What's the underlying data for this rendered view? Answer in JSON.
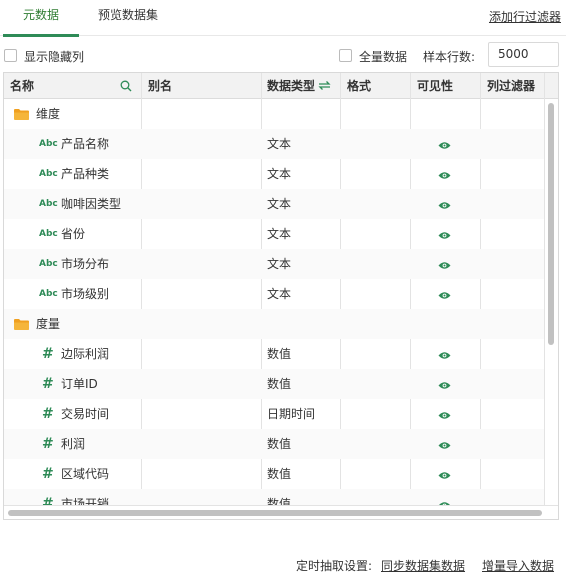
{
  "tabs": [
    {
      "label": "元数据",
      "active": true
    },
    {
      "label": "预览数据集",
      "active": false
    }
  ],
  "row_filter_link": "添加行过滤器",
  "options": {
    "show_hidden_label": "显示隐藏列",
    "all_data_label": "全量数据",
    "sample_rows_label": "样本行数:",
    "sample_rows_value": "5000"
  },
  "table": {
    "headers": {
      "name": "名称",
      "alias": "别名",
      "data_type": "数据类型",
      "format": "格式",
      "visibility": "可见性",
      "column_filter": "列过滤器"
    },
    "rows": [
      {
        "kind": "folder",
        "name": "维度"
      },
      {
        "kind": "text",
        "icon": "Abc",
        "name": "产品名称",
        "type": "文本",
        "visible": true
      },
      {
        "kind": "text",
        "icon": "Abc",
        "name": "产品种类",
        "type": "文本",
        "visible": true
      },
      {
        "kind": "text",
        "icon": "Abc",
        "name": "咖啡因类型",
        "type": "文本",
        "visible": true
      },
      {
        "kind": "text",
        "icon": "Abc",
        "name": "省份",
        "type": "文本",
        "visible": true
      },
      {
        "kind": "text",
        "icon": "Abc",
        "name": "市场分布",
        "type": "文本",
        "visible": true
      },
      {
        "kind": "text",
        "icon": "Abc",
        "name": "市场级别",
        "type": "文本",
        "visible": true
      },
      {
        "kind": "folder",
        "name": "度量"
      },
      {
        "kind": "number",
        "icon": "#",
        "name": "边际利润",
        "type": "数值",
        "visible": true
      },
      {
        "kind": "number",
        "icon": "#",
        "name": "订单ID",
        "type": "数值",
        "visible": true
      },
      {
        "kind": "number",
        "icon": "#",
        "name": "交易时间",
        "type": "日期时间",
        "visible": true
      },
      {
        "kind": "number",
        "icon": "#",
        "name": "利润",
        "type": "数值",
        "visible": true
      },
      {
        "kind": "number",
        "icon": "#",
        "name": "区域代码",
        "type": "数值",
        "visible": true
      },
      {
        "kind": "number",
        "icon": "#",
        "name": "市场开销",
        "type": "数值",
        "visible": true
      }
    ]
  },
  "footer": {
    "schedule_label": "定时抽取设置:",
    "sync_link": "同步数据集数据",
    "incremental_link": "增量导入数据"
  },
  "colors": {
    "accent": "#2e8b57",
    "folder": "#f5a623",
    "header_bg": "#f2f2f2"
  }
}
